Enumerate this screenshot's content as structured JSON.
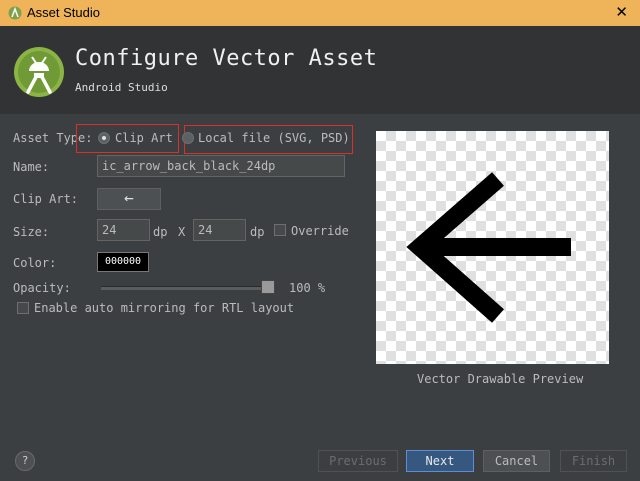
{
  "window": {
    "title": "Asset Studio",
    "close_glyph": "✕",
    "accent_color": "#efb35a"
  },
  "header": {
    "title": "Configure Vector Asset",
    "subtitle": "Android Studio",
    "logo_icon": "android-studio-logo"
  },
  "form": {
    "asset_type": {
      "label": "Asset Type:",
      "options": [
        "Clip Art",
        "Local file (SVG, PSD)"
      ],
      "selected": "Clip Art"
    },
    "name": {
      "label": "Name:",
      "value": "ic_arrow_back_black_24dp"
    },
    "clip_art": {
      "label": "Clip Art:",
      "icon": "arrow-back-icon",
      "glyph": "←"
    },
    "size": {
      "label": "Size:",
      "width": "24",
      "height": "24",
      "unit": "dp",
      "separator": "X",
      "override_label": "Override",
      "override_checked": false
    },
    "color": {
      "label": "Color:",
      "value": "000000"
    },
    "opacity": {
      "label": "Opacity:",
      "value": "100 %",
      "level": 1.0
    },
    "mirroring": {
      "label": "Enable auto mirroring for RTL layout",
      "checked": false
    }
  },
  "preview": {
    "caption": "Vector Drawable Preview",
    "icon": "arrow-back-icon"
  },
  "footer": {
    "help_label": "?",
    "previous_label": "Previous",
    "next_label": "Next",
    "cancel_label": "Cancel",
    "finish_label": "Finish"
  }
}
